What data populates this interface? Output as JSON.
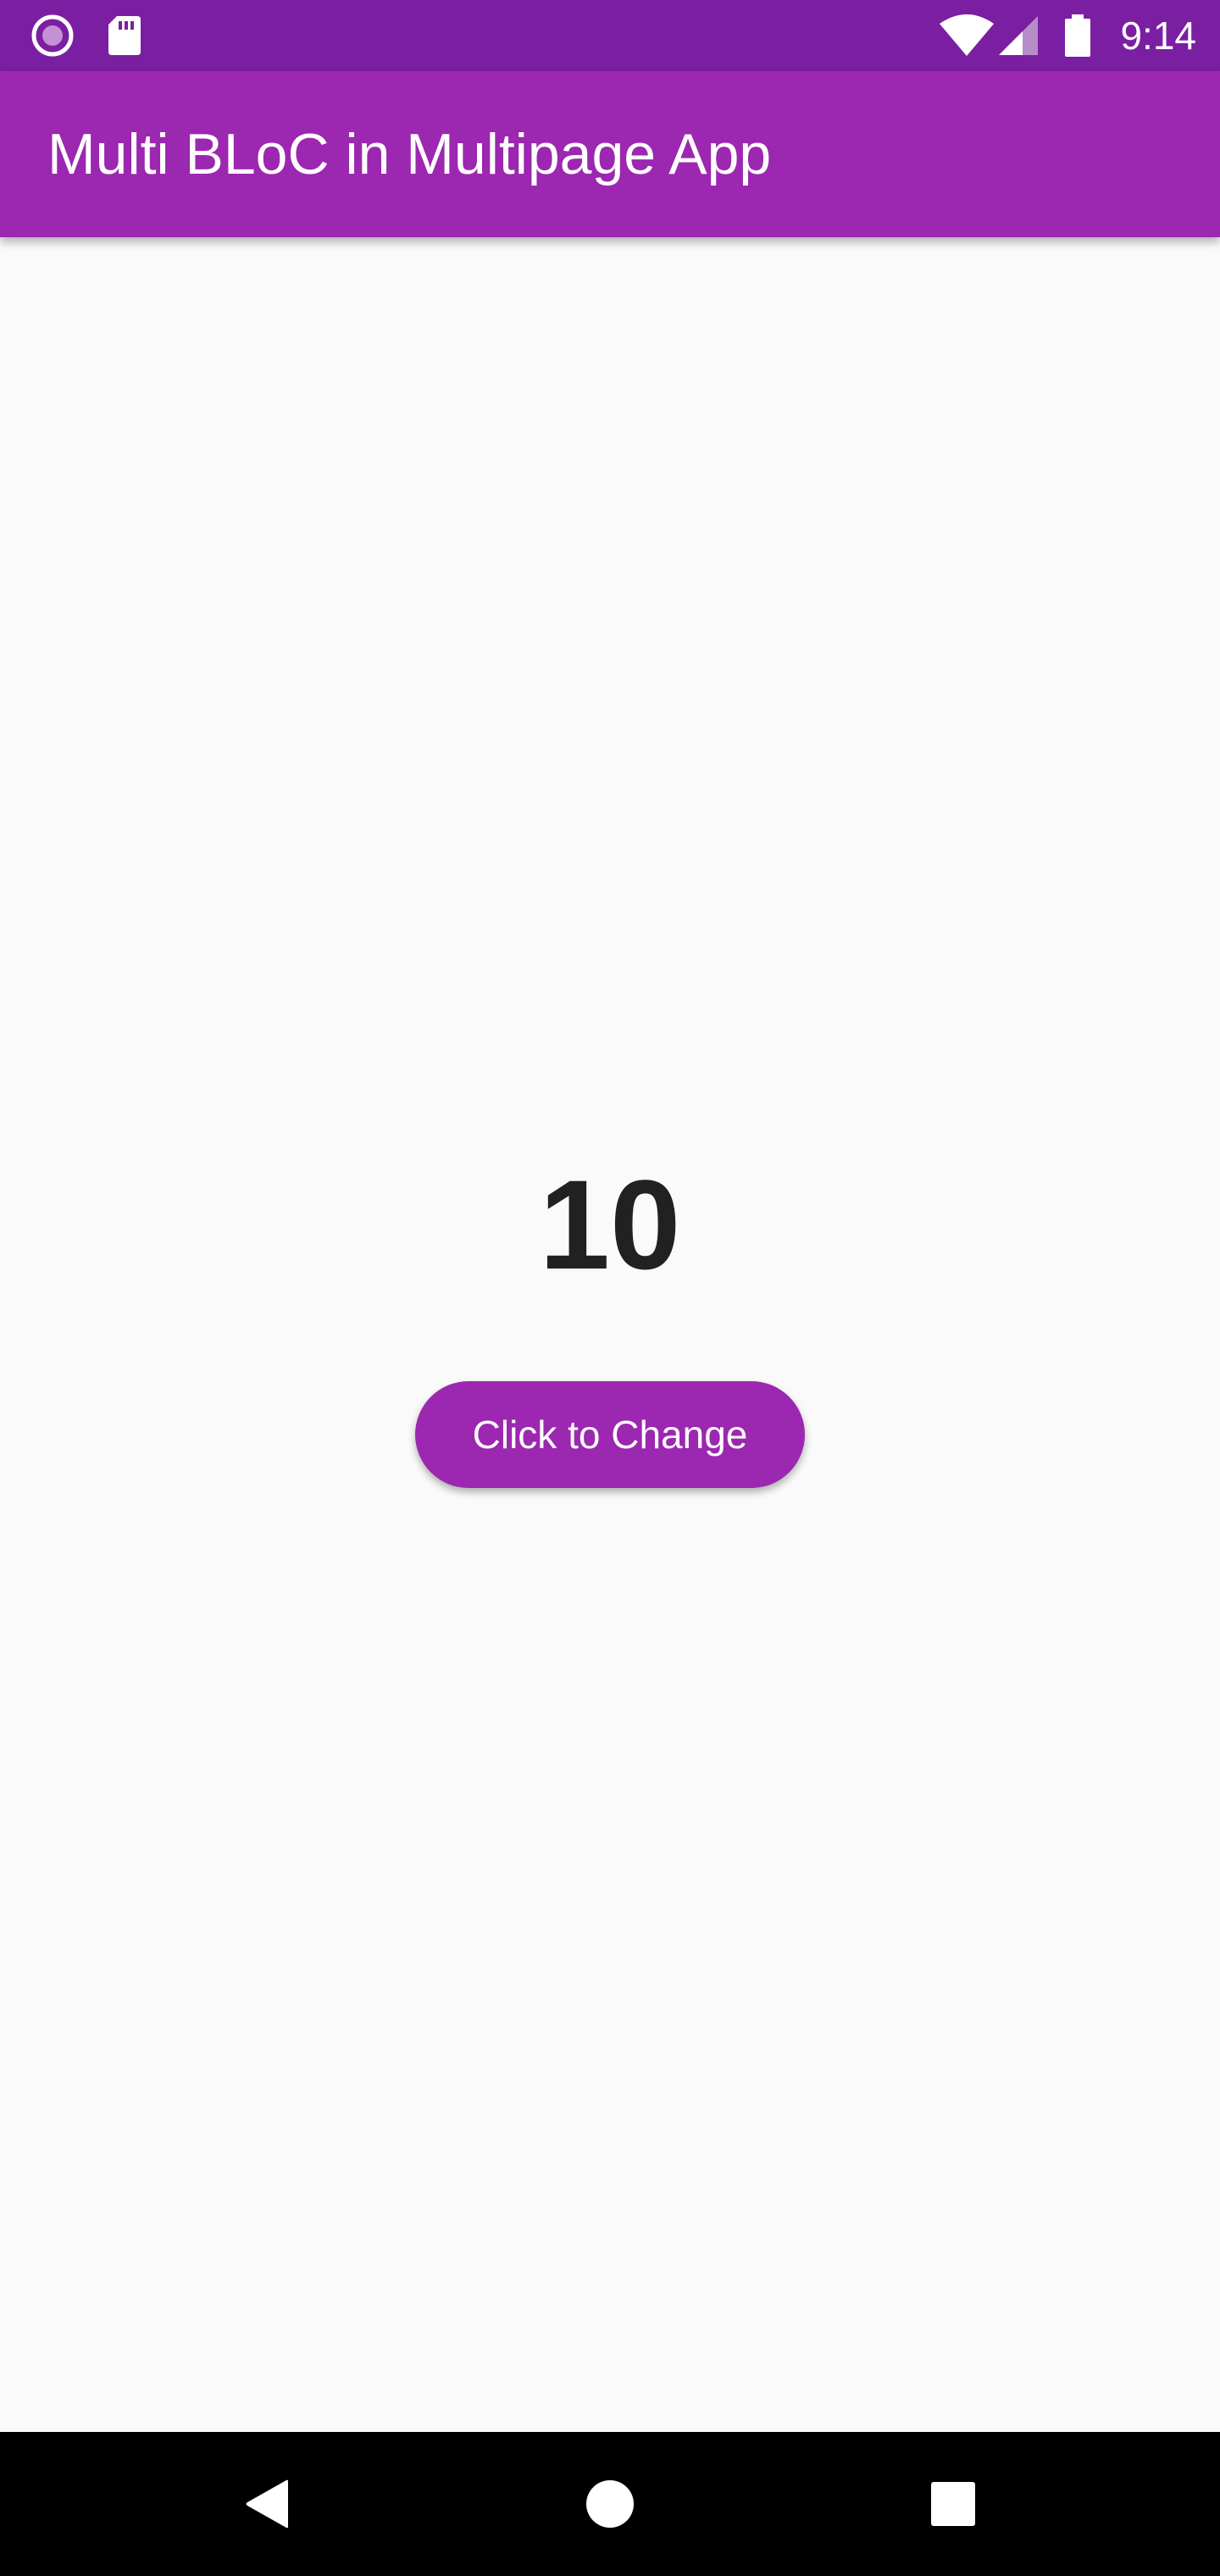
{
  "status_bar": {
    "time": "9:14",
    "icons": [
      "notification-dot-icon",
      "sd-card-icon",
      "wifi-icon",
      "signal-icon",
      "battery-icon"
    ],
    "background": "#7b1fa2"
  },
  "app_bar": {
    "title": "Multi BLoC in Multipage App",
    "background": "#9c27b0"
  },
  "main": {
    "counter_value": "10",
    "button_label": "Click to Change",
    "accent": "#9c27b0",
    "background": "#fafafa"
  },
  "nav_bar": {
    "icons": [
      "back-icon",
      "home-icon",
      "recents-icon"
    ]
  }
}
